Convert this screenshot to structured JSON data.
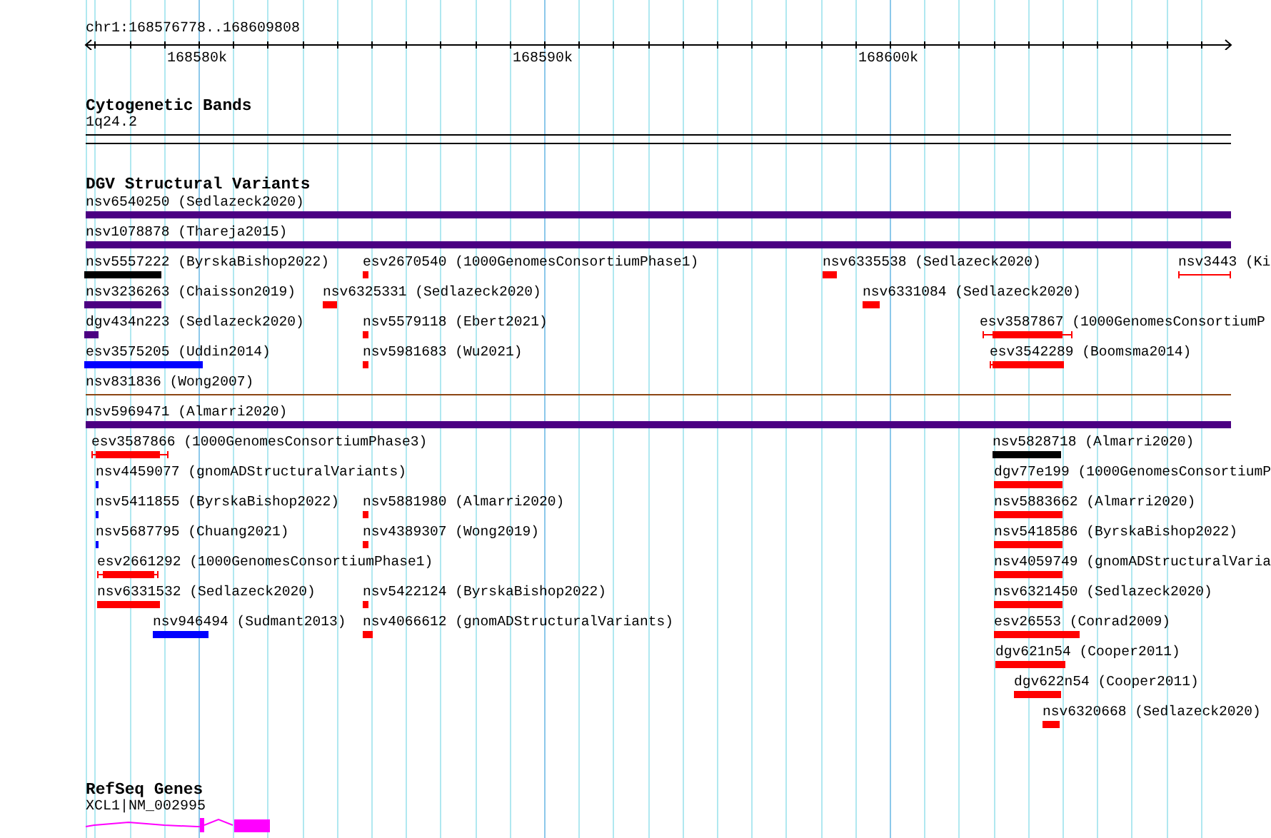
{
  "ruler": {
    "region": "chr1:168576778..168609808",
    "ticks": [
      "168580k",
      "168590k",
      "168600k"
    ]
  },
  "cytogenetic_bands": {
    "title": "Cytogenetic Bands",
    "band": "1q24.2"
  },
  "dgv": {
    "title": "DGV Structural Variants",
    "groups": [
      {
        "lanes": [
          {
            "features": [
              {
                "label": "nsv6540250 (Sedlazeck2020)",
                "kind": "bar",
                "color": "#4b0082"
              }
            ]
          },
          {
            "features": [
              {
                "label": "nsv1078878 (Thareja2015)",
                "kind": "bar",
                "color": "#4b0082"
              }
            ]
          },
          {
            "features": [
              {
                "label": "nsv5557222 (ByrskaBishop2022)",
                "kind": "bar",
                "color": "#000000"
              },
              {
                "label": "esv2670540 (1000GenomesConsortiumPhase1)",
                "kind": "bar",
                "color": "#ff0000"
              },
              {
                "label": "nsv6335538 (Sedlazeck2020)",
                "kind": "bar",
                "color": "#ff0000"
              },
              {
                "label": "nsv3443 (Ki",
                "kind": "ranged",
                "color": "#ff0000"
              }
            ]
          },
          {
            "features": [
              {
                "label": "nsv3236263 (Chaisson2019)",
                "kind": "bar",
                "color": "#4b0082"
              },
              {
                "label": "nsv6325331 (Sedlazeck2020)",
                "kind": "bar",
                "color": "#ff0000"
              },
              {
                "label": "nsv6331084 (Sedlazeck2020)",
                "kind": "bar",
                "color": "#ff0000"
              }
            ]
          },
          {
            "features": [
              {
                "label": "dgv434n223 (Sedlazeck2020)",
                "kind": "bar",
                "color": "#4b0082"
              },
              {
                "label": "nsv5579118 (Ebert2021)",
                "kind": "bar",
                "color": "#ff0000"
              },
              {
                "label": "esv3587867 (1000GenomesConsortiumP",
                "kind": "ranged",
                "color": "#ff0000"
              }
            ]
          },
          {
            "features": [
              {
                "label": "esv3575205 (Uddin2014)",
                "kind": "bar",
                "color": "#0000ff"
              },
              {
                "label": "nsv5981683 (Wu2021)",
                "kind": "bar",
                "color": "#ff0000"
              },
              {
                "label": "esv3542289 (Boomsma2014)",
                "kind": "ranged",
                "color": "#ff0000"
              }
            ]
          },
          {
            "features": [
              {
                "label": "nsv831836 (Wong2007)",
                "kind": "label"
              }
            ]
          }
        ]
      },
      {
        "lanes": [
          {
            "features": [
              {
                "label": "nsv5969471 (Almarri2020)",
                "kind": "bar",
                "color": "#4b0082"
              }
            ]
          },
          {
            "features": [
              {
                "label": "esv3587866 (1000GenomesConsortiumPhase3)",
                "kind": "ranged",
                "color": "#ff0000"
              },
              {
                "label": "nsv5828718 (Almarri2020)",
                "kind": "bar",
                "color": "#000000"
              }
            ]
          },
          {
            "features": [
              {
                "label": "nsv4459077 (gnomADStructuralVariants)",
                "kind": "bar",
                "color": "#0000ff"
              },
              {
                "label": "dgv77e199 (1000GenomesConsortiumP",
                "kind": "bar",
                "color": "#ff0000"
              }
            ]
          },
          {
            "features": [
              {
                "label": "nsv5411855 (ByrskaBishop2022)",
                "kind": "bar",
                "color": "#0000ff"
              },
              {
                "label": "nsv5881980 (Almarri2020)",
                "kind": "bar",
                "color": "#ff0000"
              },
              {
                "label": "nsv5883662 (Almarri2020)",
                "kind": "bar",
                "color": "#ff0000"
              }
            ]
          },
          {
            "features": [
              {
                "label": "nsv5687795 (Chuang2021)",
                "kind": "bar",
                "color": "#0000ff"
              },
              {
                "label": "nsv4389307 (Wong2019)",
                "kind": "bar",
                "color": "#ff0000"
              },
              {
                "label": "nsv5418586 (ByrskaBishop2022)",
                "kind": "bar",
                "color": "#ff0000"
              }
            ]
          },
          {
            "features": [
              {
                "label": "esv2661292 (1000GenomesConsortiumPhase1)",
                "kind": "ranged",
                "color": "#ff0000"
              },
              {
                "label": "nsv4059749 (gnomADStructuralVaria",
                "kind": "bar",
                "color": "#ff0000"
              }
            ]
          },
          {
            "features": [
              {
                "label": "nsv6331532 (Sedlazeck2020)",
                "kind": "bar",
                "color": "#ff0000"
              },
              {
                "label": "nsv5422124 (ByrskaBishop2022)",
                "kind": "bar",
                "color": "#ff0000"
              },
              {
                "label": "nsv6321450 (Sedlazeck2020)",
                "kind": "bar",
                "color": "#ff0000"
              }
            ]
          },
          {
            "features": [
              {
                "label": "nsv946494 (Sudmant2013)",
                "kind": "bar",
                "color": "#0000ff"
              },
              {
                "label": "nsv4066612 (gnomADStructuralVariants)",
                "kind": "bar",
                "color": "#ff0000"
              },
              {
                "label": "esv26553 (Conrad2009)",
                "kind": "bar",
                "color": "#ff0000"
              }
            ]
          },
          {
            "features": [
              {
                "label": "dgv621n54 (Cooper2011)",
                "kind": "bar",
                "color": "#ff0000"
              }
            ]
          },
          {
            "features": [
              {
                "label": "dgv622n54 (Cooper2011)",
                "kind": "bar",
                "color": "#ff0000"
              }
            ]
          },
          {
            "features": [
              {
                "label": "nsv6320668 (Sedlazeck2020)",
                "kind": "bar",
                "color": "#ff0000"
              }
            ]
          }
        ]
      }
    ]
  },
  "refseq": {
    "title": "RefSeq Genes",
    "gene": "XCL1|NM_002995"
  }
}
